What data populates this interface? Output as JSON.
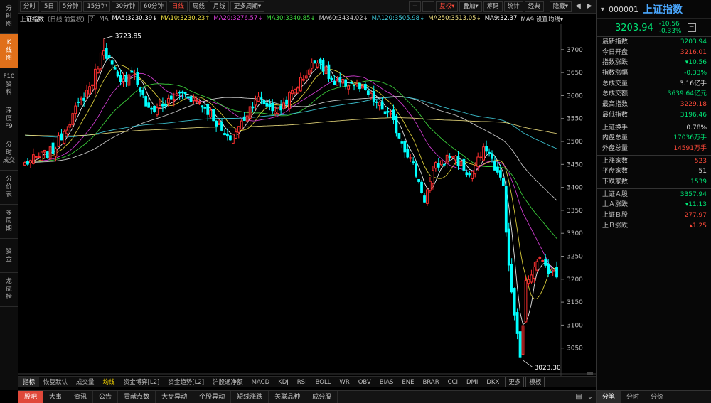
{
  "sidebar": [
    {
      "lines": [
        "分",
        "时",
        "图"
      ],
      "active": false
    },
    {
      "lines": [
        "K",
        "线",
        "图"
      ],
      "active": true
    },
    {
      "lines": [
        "F10",
        "资",
        "料"
      ],
      "active": false
    },
    {
      "lines": [
        "深",
        "度",
        "F9"
      ],
      "active": false
    },
    {
      "lines": [
        "分",
        "时",
        "成交"
      ],
      "active": false
    },
    {
      "lines": [
        "分",
        "价",
        "表"
      ],
      "active": false
    },
    {
      "lines": [
        "多",
        "周",
        "期"
      ],
      "active": false
    },
    {
      "lines": [
        "资",
        "金"
      ],
      "active": false
    },
    {
      "lines": [
        "龙",
        "虎",
        "榜"
      ],
      "active": false
    }
  ],
  "toolbar": {
    "periods": [
      "分时",
      "5日",
      "5分钟",
      "15分钟",
      "30分钟",
      "60分钟",
      "日线",
      "周线",
      "月线",
      "更多周期"
    ],
    "active_period": "日线",
    "more_arrow": "▾",
    "plus": "+",
    "minus": "−",
    "fuquan": "复权",
    "diejia": "叠加",
    "chouma": "筹码",
    "tongji": "统计",
    "jingdian": "经典",
    "hide": "隐藏"
  },
  "ma_legend": {
    "title": "上证指数",
    "subtitle": "(日线,前复权)",
    "items": [
      {
        "text": "MA5:3230.39",
        "arrow": "↓",
        "color": "#ffffff"
      },
      {
        "text": "MA10:3230.23",
        "arrow": "↑",
        "color": "#f0e040"
      },
      {
        "text": "MA20:3276.57",
        "arrow": "↓",
        "color": "#e040e0"
      },
      {
        "text": "MA30:3340.85",
        "arrow": "↓",
        "color": "#40e040"
      },
      {
        "text": "MA60:3434.02",
        "arrow": "↓",
        "color": "#d8d8d8"
      },
      {
        "text": "MA120:3505.98",
        "arrow": "↓",
        "color": "#40d0e0"
      },
      {
        "text": "MA250:3513.05",
        "arrow": "↓",
        "color": "#f0e080"
      },
      {
        "text": "MA9:32.37",
        "arrow": "",
        "color": "#ffffff"
      },
      {
        "text": "MA9:设置均线",
        "arrow": "▾",
        "color": "#d8d8d8"
      }
    ]
  },
  "chart_data": {
    "type": "candlestick",
    "ylim": [
      3000,
      3740
    ],
    "yticks": [
      3050,
      3100,
      3150,
      3200,
      3250,
      3300,
      3350,
      3400,
      3450,
      3500,
      3550,
      3600,
      3650,
      3700
    ],
    "annotations": [
      {
        "label": "3723.85",
        "index": 28,
        "value": 3723.85
      },
      {
        "label": "3023.30",
        "index": 177,
        "value": 3023.3
      }
    ],
    "up_color": "#ff3030",
    "down_color": "#00ffff",
    "anchors": [
      [
        0,
        3452
      ],
      [
        10,
        3480
      ],
      [
        18,
        3568
      ],
      [
        24,
        3630
      ],
      [
        28,
        3705
      ],
      [
        34,
        3622
      ],
      [
        38,
        3658
      ],
      [
        44,
        3566
      ],
      [
        50,
        3582
      ],
      [
        56,
        3608
      ],
      [
        62,
        3585
      ],
      [
        66,
        3562
      ],
      [
        72,
        3502
      ],
      [
        76,
        3530
      ],
      [
        82,
        3595
      ],
      [
        90,
        3565
      ],
      [
        98,
        3632
      ],
      [
        104,
        3682
      ],
      [
        110,
        3622
      ],
      [
        116,
        3628
      ],
      [
        122,
        3602
      ],
      [
        130,
        3552
      ],
      [
        138,
        3448
      ],
      [
        142,
        3375
      ],
      [
        146,
        3445
      ],
      [
        152,
        3472
      ],
      [
        158,
        3425
      ],
      [
        164,
        3488
      ],
      [
        170,
        3402
      ],
      [
        172,
        3222
      ],
      [
        176,
        3025
      ],
      [
        178,
        3188
      ],
      [
        182,
        3248
      ],
      [
        186,
        3222
      ],
      [
        189,
        3206
      ]
    ],
    "ma_series": [
      {
        "name": "MA5",
        "period": 5,
        "color": "#ffffff"
      },
      {
        "name": "MA10",
        "period": 10,
        "color": "#f0e040"
      },
      {
        "name": "MA20",
        "period": 20,
        "color": "#e040e0"
      },
      {
        "name": "MA30",
        "period": 30,
        "color": "#40e040"
      },
      {
        "name": "MA60",
        "period": 60,
        "color": "#d8d8d8"
      },
      {
        "name": "MA120",
        "period": 120,
        "color": "#40d0e0"
      },
      {
        "name": "MA250",
        "period": 250,
        "color": "#f0e080"
      }
    ]
  },
  "indicator_tabs": [
    "指标",
    "恢复默认",
    "成交量",
    "均线",
    "资金博弈[L2]",
    "资金趋势[L2]",
    "沪股通净额",
    "MACD",
    "KDJ",
    "RSI",
    "BOLL",
    "WR",
    "OBV",
    "BIAS",
    "ENE",
    "BRAR",
    "CCI",
    "DMI",
    "DKX",
    "更多",
    "模板"
  ],
  "bottom_tabs": [
    "股吧",
    "大事",
    "资讯",
    "公告",
    "贡献点数",
    "大盘异动",
    "个股异动",
    "短线涨跌",
    "关联品种",
    "成分股"
  ],
  "quote": {
    "code": "000001",
    "name": "上证指数",
    "price": "3203.94",
    "change": "-10.56",
    "change_pct": "-0.33%",
    "minus_btn": "−",
    "rows": [
      {
        "label": "最新指数",
        "value": "3203.94",
        "cls": "down"
      },
      {
        "label": "今日开盘",
        "value": "3216.01",
        "cls": "up"
      },
      {
        "label": "指数涨跌",
        "value": "▾10.56",
        "cls": "down"
      },
      {
        "label": "指数涨幅",
        "value": "-0.33%",
        "cls": "down"
      },
      {
        "label": "总成交量",
        "value": "3.16亿手",
        "cls": "neu"
      },
      {
        "label": "总成交额",
        "value": "3639.64亿元",
        "cls": "down"
      },
      {
        "label": "最高指数",
        "value": "3229.18",
        "cls": "up"
      },
      {
        "label": "最低指数",
        "value": "3196.46",
        "cls": "down"
      },
      {
        "sep": true
      },
      {
        "label": "上证换手",
        "value": "0.78%",
        "cls": "neu"
      },
      {
        "label": "内盘总量",
        "value": "17036万手",
        "cls": "down"
      },
      {
        "label": "外盘总量",
        "value": "14591万手",
        "cls": "up"
      },
      {
        "sep": true
      },
      {
        "label": "上涨家数",
        "value": "523",
        "cls": "up"
      },
      {
        "label": "平盘家数",
        "value": "51",
        "cls": "neu"
      },
      {
        "label": "下跌家数",
        "value": "1539",
        "cls": "down"
      },
      {
        "sep": true
      },
      {
        "label": "上证Ａ股",
        "value": "3357.94",
        "cls": "down"
      },
      {
        "label": "上Ａ涨跌",
        "value": "▾11.13",
        "cls": "down"
      },
      {
        "label": "上证Ｂ股",
        "value": "277.97",
        "cls": "up"
      },
      {
        "label": "上Ｂ涨跌",
        "value": "▴1.25",
        "cls": "up"
      }
    ]
  },
  "right_tabs": [
    "分笔",
    "分时",
    "分价"
  ]
}
